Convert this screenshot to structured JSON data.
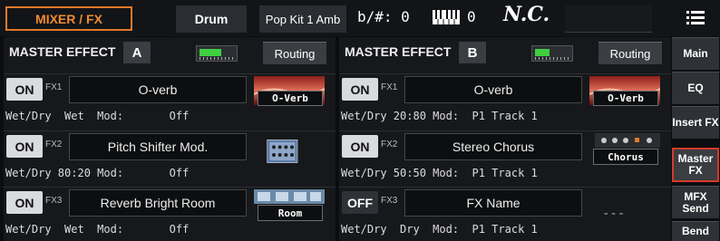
{
  "topbar": {
    "title": "MIXER / FX",
    "style": "Drum",
    "performance": "Pop Kit 1 Amb",
    "keysig": "b/#: 0",
    "transpose": "0",
    "chord": "N.C.",
    "menu_icon": "hamburger-menu-icon"
  },
  "panels": [
    {
      "title": "MASTER EFFECT",
      "letter": "A",
      "meter_level": 0.6,
      "routing": "Routing",
      "fx": [
        {
          "state": "ON",
          "num": "FX1",
          "name": "O-verb",
          "params": "Wet/Dry  Wet  Mod:       Off",
          "tag": "O-Verb",
          "icon": "reverb-thumbnail-icon"
        },
        {
          "state": "ON",
          "num": "FX2",
          "name": "Pitch Shifter Mod.",
          "params": "Wet/Dry 80:20 Mod:       Off",
          "tag": "",
          "icon": "pitch-shifter-thumbnail-icon"
        },
        {
          "state": "ON",
          "num": "FX3",
          "name": "Reverb Bright Room",
          "params": "Wet/Dry  Wet  Mod:       Off",
          "tag": "Room",
          "icon": "room-reverb-thumbnail-icon"
        }
      ]
    },
    {
      "title": "MASTER EFFECT",
      "letter": "B",
      "meter_level": 0.4,
      "routing": "Routing",
      "fx": [
        {
          "state": "ON",
          "num": "FX1",
          "name": "O-verb",
          "params": "Wet/Dry 20:80 Mod:  P1 Track 1",
          "tag": "O-Verb",
          "icon": "reverb-thumbnail-icon"
        },
        {
          "state": "ON",
          "num": "FX2",
          "name": "Stereo Chorus",
          "params": "Wet/Dry 50:50 Mod:  P1 Track 1",
          "tag": "Chorus",
          "icon": "chorus-thumbnail-icon"
        },
        {
          "state": "OFF",
          "num": "FX3",
          "name": "FX Name",
          "params": "Wet/Dry  Dry  Mod:  P1 Track 1",
          "tag": "---",
          "icon": ""
        }
      ]
    }
  ],
  "tabs": [
    "Main",
    "EQ",
    "Insert FX",
    "Master FX",
    "MFX Send",
    "Bend"
  ],
  "active_tab": "Master FX",
  "colors": {
    "accent": "#e07a2a",
    "active_tab_border": "#d63a2a",
    "meter": "#3fcf3f"
  }
}
